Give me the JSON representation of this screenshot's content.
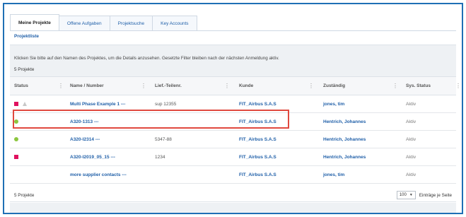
{
  "tabs": [
    {
      "label": "Meine Projekte",
      "active": true
    },
    {
      "label": "Offene Aufgaben",
      "active": false
    },
    {
      "label": "Projektsuche",
      "active": false
    },
    {
      "label": "Key Accounts",
      "active": false
    }
  ],
  "subtitle": "Projektliste",
  "info_text": "Klicken Sie bitte auf den Namen des Projektes, um die Details anzusehen. Gesetzte Filter bleiben nach der nächsten Anmeldung aktiv.",
  "count_label": "5 Projekte",
  "columns": {
    "status": "Status",
    "name": "Name / Number",
    "supplier": "Lief.-Teilenr.",
    "customer": "Kunde",
    "owner": "Zuständig",
    "sys_status": "Sys. Status"
  },
  "column_menu_icon": "⋮",
  "rows": [
    {
      "status_icons": [
        "red-square",
        "gray-triangle"
      ],
      "name": "Multi Phase Example 1 ---",
      "supplier": "sup 12355",
      "customer": "FIT_Airbus S.A.S",
      "owner": "jones, tim",
      "sys_status": "Aktiv"
    },
    {
      "status_icons": [
        "green-dot"
      ],
      "name": "A320-1313 ---",
      "supplier": "",
      "customer": "FIT_Airbus S.A.S",
      "owner": "Hentrich, Johannes",
      "sys_status": "Aktiv",
      "highlighted": true
    },
    {
      "status_icons": [
        "green-dot"
      ],
      "name": "A320-I2314 ---",
      "supplier": "5347-88",
      "customer": "FIT_Airbus S.A.S",
      "owner": "Hentrich, Johannes",
      "sys_status": "Aktiv"
    },
    {
      "status_icons": [
        "red-square"
      ],
      "name": "A320-I2019_05_15 ---",
      "supplier": "1234",
      "customer": "FIT_Airbus S.A.S",
      "owner": "Hentrich, Johannes",
      "sys_status": "Aktiv"
    },
    {
      "status_icons": [],
      "name": "more supplier contacts ---",
      "supplier": "",
      "customer": "FIT_Airbus S.A.S",
      "owner": "jones, tim",
      "sys_status": "Aktiv"
    }
  ],
  "footer": {
    "count_label": "5 Projekte",
    "page_size": "100",
    "page_size_caret": "▼",
    "per_page_label": "Einträge je Seite"
  },
  "colors": {
    "accent": "#1f5fa8",
    "frame": "#1f6fb5",
    "status_red": "#e0115f",
    "status_green": "#8cc63f",
    "status_gray": "#c8c8c8",
    "highlight": "#e0493f"
  }
}
